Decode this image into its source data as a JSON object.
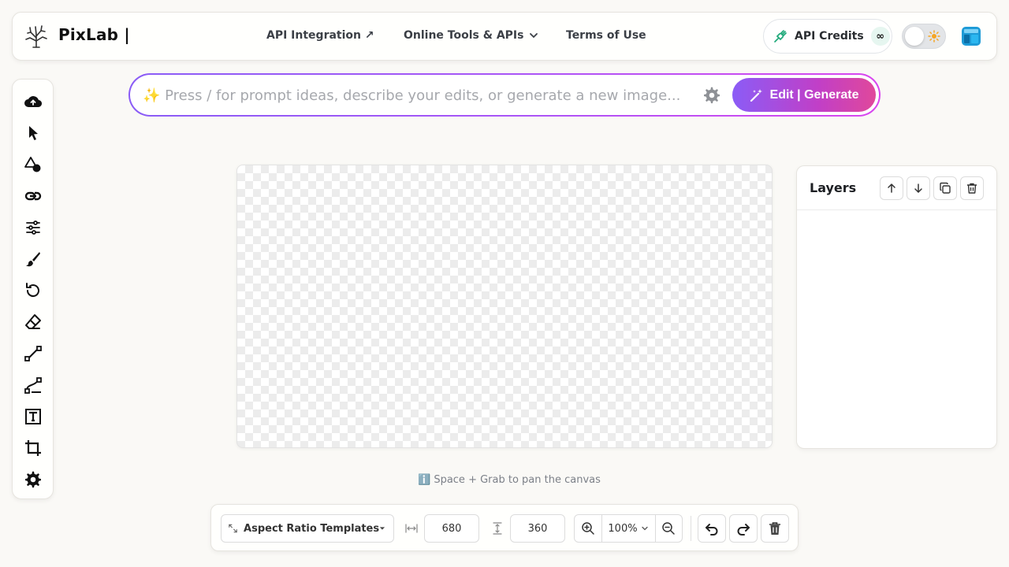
{
  "header": {
    "brand": "PixLab |",
    "nav_api": "API Integration ↗",
    "nav_tools": "Online Tools & APIs",
    "nav_terms": "Terms of Use",
    "credits_label": "API Credits",
    "credits_badge": "∞"
  },
  "prompt": {
    "placeholder": "✨ Press / for prompt ideas, describe your edits, or generate a new image...",
    "button_label": "Edit | Generate"
  },
  "canvas": {
    "hint": "ℹ️ Space + Grab to pan the canvas"
  },
  "layers": {
    "title": "Layers"
  },
  "bottom": {
    "aspect_label": "Aspect Ratio Templates",
    "width": "680",
    "height": "360",
    "zoom": "100%"
  },
  "colors": {
    "accent_start": "#8b5cf6",
    "accent_end": "#e0489b",
    "background": "#faf9f6"
  },
  "toolbar_icons": [
    "upload-cloud-icon",
    "select-pointer-icon",
    "shapes-icon",
    "link-icon",
    "adjustments-icon",
    "brush-icon",
    "undo-history-icon",
    "eraser-icon",
    "line-icon",
    "path-pen-icon",
    "text-icon",
    "crop-icon",
    "settings-gear-icon"
  ]
}
